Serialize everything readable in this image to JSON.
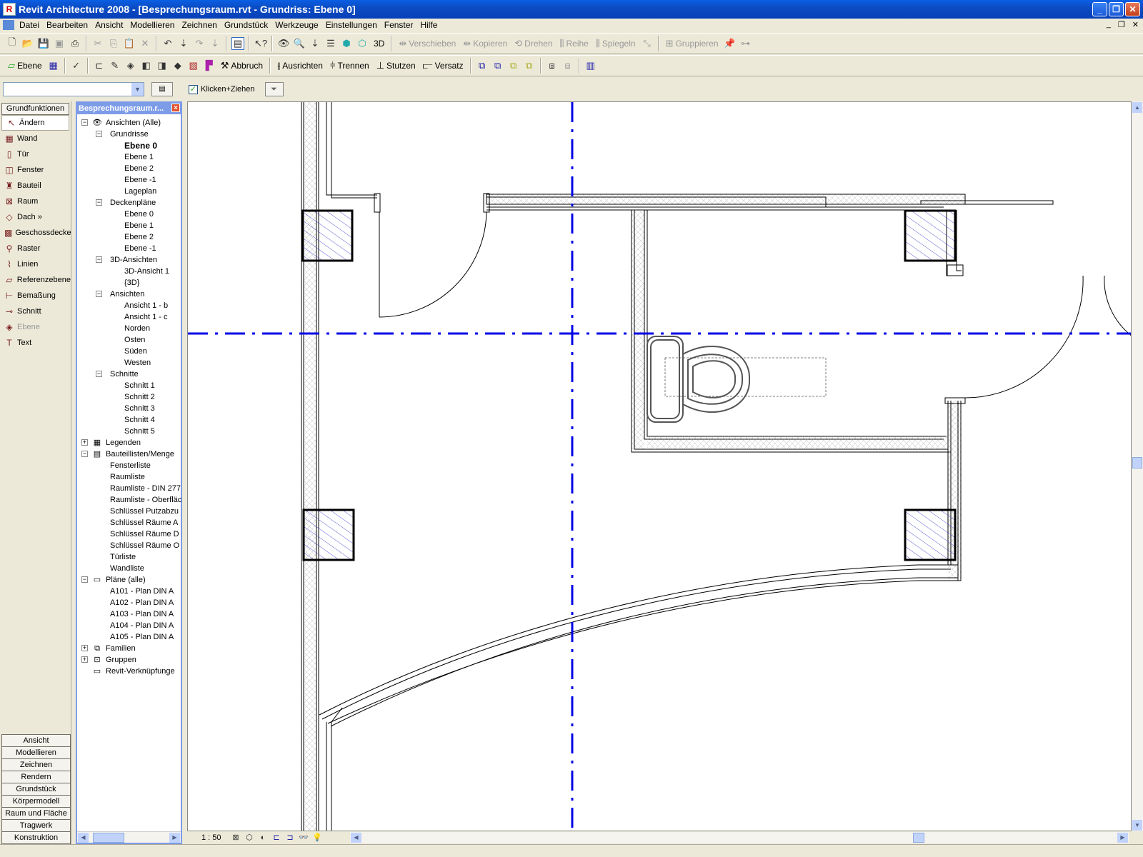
{
  "window": {
    "title": "Revit Architecture 2008 - [Besprechungsraum.rvt - Grundriss: Ebene 0]",
    "controls": [
      "_",
      "❐",
      "✕"
    ]
  },
  "menu": {
    "items": [
      "Datei",
      "Bearbeiten",
      "Ansicht",
      "Modellieren",
      "Zeichnen",
      "Grundstück",
      "Werkzeuge",
      "Einstellungen",
      "Fenster",
      "Hilfe"
    ],
    "mdi_controls": [
      "_",
      "❐",
      "✕"
    ]
  },
  "toolbar1": {
    "label_3d": "3D",
    "verschieben": "Verschieben",
    "kopieren": "Kopieren",
    "drehen": "Drehen",
    "reihe": "Reihe",
    "spiegeln": "Spiegeln",
    "gruppieren": "Gruppieren"
  },
  "toolbar2": {
    "ebene": "Ebene",
    "abbruch": "Abbruch",
    "ausrichten": "Ausrichten",
    "trennen": "Trennen",
    "stutzen": "Stutzen",
    "versatz": "Versatz"
  },
  "options": {
    "checkbox_label": "Klicken+Ziehen",
    "checked": true
  },
  "design_bar": {
    "header": "Grundfunktionen",
    "items": [
      {
        "label": "Ändern",
        "icon": "cursor-arrow-icon",
        "glyph": "↖",
        "active": true
      },
      {
        "label": "Wand",
        "icon": "wall-icon",
        "glyph": "▦"
      },
      {
        "label": "Tür",
        "icon": "door-icon",
        "glyph": "▯"
      },
      {
        "label": "Fenster",
        "icon": "window-icon",
        "glyph": "◫"
      },
      {
        "label": "Bauteil",
        "icon": "component-icon",
        "glyph": "♜"
      },
      {
        "label": "Raum",
        "icon": "room-icon",
        "glyph": "⊠"
      },
      {
        "label": "Dach »",
        "icon": "roof-icon",
        "glyph": "◇"
      },
      {
        "label": "Geschossdecke",
        "icon": "floor-icon",
        "glyph": "▩"
      },
      {
        "label": "Raster",
        "icon": "grid-icon",
        "glyph": "⚲"
      },
      {
        "label": "Linien",
        "icon": "lines-icon",
        "glyph": "⌇"
      },
      {
        "label": "Referenzebene",
        "icon": "reference-plane-icon",
        "glyph": "▱"
      },
      {
        "label": "Bemaßung",
        "icon": "dimension-icon",
        "glyph": "⊢"
      },
      {
        "label": "Schnitt",
        "icon": "section-icon",
        "glyph": "⊸"
      },
      {
        "label": "Ebene",
        "icon": "level-icon",
        "glyph": "◈",
        "disabled": true
      },
      {
        "label": "Text",
        "icon": "text-icon",
        "glyph": "T"
      }
    ],
    "tabs": [
      "Ansicht",
      "Modellieren",
      "Zeichnen",
      "Rendern",
      "Grundstück",
      "Körpermodell",
      "Raum und Fläche",
      "Tragwerk",
      "Konstruktion"
    ]
  },
  "project_browser": {
    "title": "Besprechungsraum.r...",
    "tree": [
      {
        "label": "Ansichten (Alle)",
        "level": 0,
        "expander": "−",
        "icon": "eye-icon",
        "glyph": "👁"
      },
      {
        "label": "Grundrisse",
        "level": 1,
        "expander": "−"
      },
      {
        "label": "Ebene 0",
        "level": 2,
        "bold": true
      },
      {
        "label": "Ebene 1",
        "level": 2
      },
      {
        "label": "Ebene 2",
        "level": 2
      },
      {
        "label": "Ebene -1",
        "level": 2
      },
      {
        "label": "Lageplan",
        "level": 2
      },
      {
        "label": "Deckenpläne",
        "level": 1,
        "expander": "−"
      },
      {
        "label": "Ebene 0",
        "level": 2
      },
      {
        "label": "Ebene 1",
        "level": 2
      },
      {
        "label": "Ebene 2",
        "level": 2
      },
      {
        "label": "Ebene -1",
        "level": 2
      },
      {
        "label": "3D-Ansichten",
        "level": 1,
        "expander": "−"
      },
      {
        "label": "3D-Ansicht 1",
        "level": 2
      },
      {
        "label": "{3D}",
        "level": 2
      },
      {
        "label": "Ansichten",
        "level": 1,
        "expander": "−"
      },
      {
        "label": "Ansicht 1 - b",
        "level": 2
      },
      {
        "label": "Ansicht 1 - c",
        "level": 2
      },
      {
        "label": "Norden",
        "level": 2
      },
      {
        "label": "Osten",
        "level": 2
      },
      {
        "label": "Süden",
        "level": 2
      },
      {
        "label": "Westen",
        "level": 2
      },
      {
        "label": "Schnitte",
        "level": 1,
        "expander": "−"
      },
      {
        "label": "Schnitt 1",
        "level": 2
      },
      {
        "label": "Schnitt 2",
        "level": 2
      },
      {
        "label": "Schnitt 3",
        "level": 2
      },
      {
        "label": "Schnitt 4",
        "level": 2
      },
      {
        "label": "Schnitt 5",
        "level": 2
      },
      {
        "label": "Legenden",
        "level": 0,
        "expander": "+",
        "icon": "legend-icon",
        "glyph": "▦"
      },
      {
        "label": "Bauteillisten/Menge",
        "level": 0,
        "expander": "−",
        "icon": "schedule-icon",
        "glyph": "▤"
      },
      {
        "label": "Fensterliste",
        "level": 1
      },
      {
        "label": "Raumliste",
        "level": 1
      },
      {
        "label": "Raumliste - DIN 277",
        "level": 1
      },
      {
        "label": "Raumliste - Oberfläc",
        "level": 1
      },
      {
        "label": "Schlüssel Putzabzu",
        "level": 1
      },
      {
        "label": "Schlüssel Räume A",
        "level": 1
      },
      {
        "label": "Schlüssel Räume D",
        "level": 1
      },
      {
        "label": "Schlüssel Räume O",
        "level": 1
      },
      {
        "label": "Türliste",
        "level": 1
      },
      {
        "label": "Wandliste",
        "level": 1
      },
      {
        "label": "Pläne (alle)",
        "level": 0,
        "expander": "−",
        "icon": "sheet-icon",
        "glyph": "▭"
      },
      {
        "label": "A101 - Plan DIN A",
        "level": 1
      },
      {
        "label": "A102 - Plan DIN A",
        "level": 1
      },
      {
        "label": "A103 - Plan DIN A",
        "level": 1
      },
      {
        "label": "A104 - Plan DIN A",
        "level": 1
      },
      {
        "label": "A105 - Plan DIN A",
        "level": 1
      },
      {
        "label": "Familien",
        "level": 0,
        "expander": "+",
        "icon": "family-icon",
        "glyph": "⧉"
      },
      {
        "label": "Gruppen",
        "level": 0,
        "expander": "+",
        "icon": "group-icon",
        "glyph": "⊡"
      },
      {
        "label": "Revit-Verknüpfunge",
        "level": 0,
        "icon": "link-icon",
        "glyph": "▭"
      }
    ]
  },
  "view_control_bar": {
    "scale": "1 : 50"
  },
  "colors": {
    "grid_line": "#0000e6",
    "column_hatch": "#3333cc",
    "wall": "#000000",
    "browser_border": "#7d9ce8"
  }
}
